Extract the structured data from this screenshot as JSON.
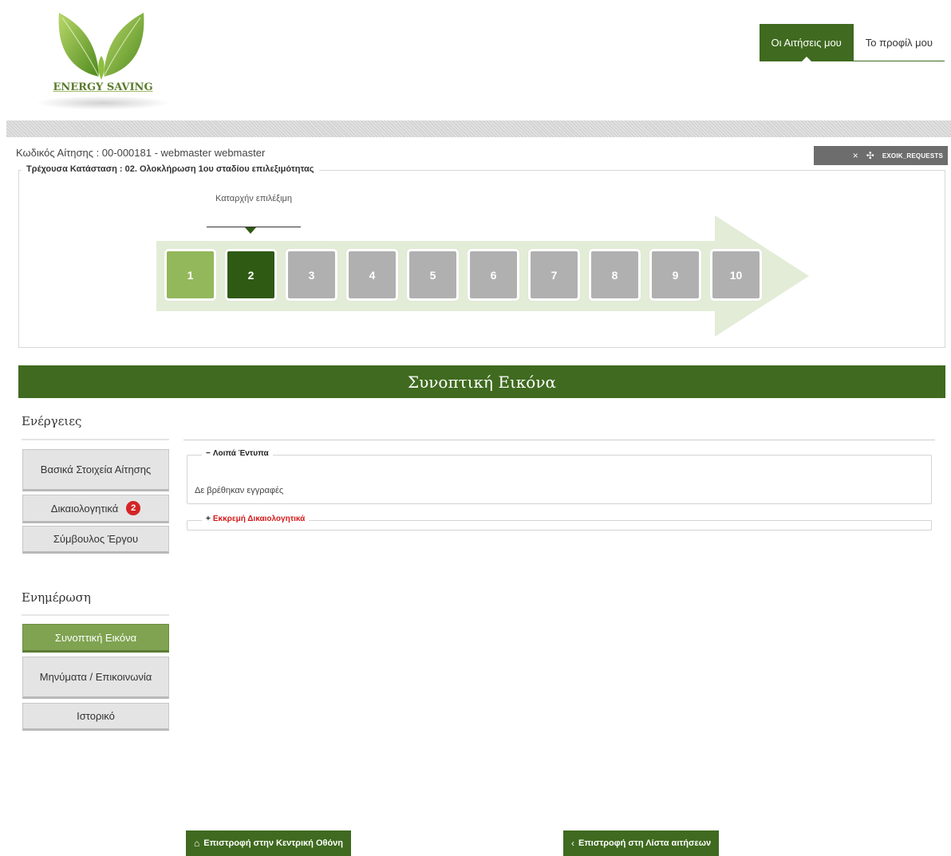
{
  "header": {
    "logo_text": "ENERGY SAVING",
    "tabs": [
      {
        "label": "Οι Αιτήσεις μου",
        "active": true
      },
      {
        "label": "Το προφίλ μου",
        "active": false
      }
    ]
  },
  "application": {
    "code_line": "Κωδικός Αίτησης : 00-000181 - webmaster webmaster",
    "status_legend": "Τρέχουσα Κατάσταση : 02. Ολοκλήρωση 1ου σταδίου επιλεξιμότητας",
    "current_step_caption": "Καταρχήν επιλέξιμη",
    "steps": [
      "1",
      "2",
      "3",
      "4",
      "5",
      "6",
      "7",
      "8",
      "9",
      "10"
    ],
    "current_step": 2
  },
  "dev_toolbar": {
    "close": "×",
    "plus": "✣",
    "label": "EXOIK_REQUESTS"
  },
  "banner": {
    "title": "Συνοπτική Εικόνα"
  },
  "sidebar": {
    "actions_heading": "Ενέργειες",
    "actions": [
      {
        "label": "Βασικά Στοιχεία Αίτησης"
      },
      {
        "label": "Δικαιολογητικά",
        "badge": "2"
      },
      {
        "label": "Σύμβουλος Έργου"
      }
    ],
    "info_heading": "Ενημέρωση",
    "info": [
      {
        "label": "Συνοπτική Εικόνα",
        "active": true
      },
      {
        "label": "Μηνύματα / Επικοινωνία"
      },
      {
        "label": "Ιστορικό"
      }
    ]
  },
  "panels": {
    "other_forms": {
      "symbol": "−",
      "title": "Λοιπά Έντυπα",
      "empty_text": "Δε βρέθηκαν εγγραφές"
    },
    "pending_docs": {
      "symbol": "+",
      "title": "Εκκρεμή Δικαιολογητικά",
      "title_color": "#d41b1b"
    }
  },
  "footer": {
    "home_icon": "⌂",
    "home_label": "Επιστροφή στην Κεντρική Οθόνη",
    "back_icon": "‹",
    "back_label": "Επιστροφή στη Λίστα αιτήσεων"
  },
  "colors": {
    "brand_green": "#3f6a1f",
    "step_done": "#93b85b",
    "step_current": "#2f5a14",
    "step_todo": "#b0b0b0",
    "badge_red": "#d42426"
  }
}
